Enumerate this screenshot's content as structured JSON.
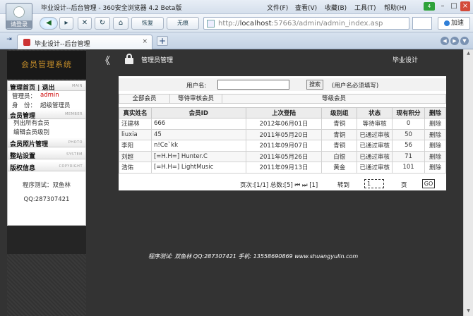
{
  "browser": {
    "title": "毕业设计--后台管理 - 360安全浏览器 4.2 Beta版",
    "menu": [
      "文件(F)",
      "查看(V)",
      "收藏(B)",
      "工具(T)",
      "帮助(H)"
    ],
    "badge_count": "4",
    "logo_label": "请登录",
    "toolbar": {
      "back_icon": "◀",
      "restore_label": "恢复",
      "notrace_label": "无痕"
    },
    "url_prefix": "http://",
    "url_host": "localhost",
    "url_rest": ":57663/admin/admin_index.asp",
    "speed_label": "加速",
    "tab_title": "毕业设计--后台管理",
    "tab_close": "×",
    "new_tab": "+"
  },
  "sidebar": {
    "banner": "会员管理系统",
    "sections": [
      {
        "title": "管理首页 | 退出",
        "en": "MAIN"
      },
      {
        "title": "会员管理",
        "en": "MEMBER"
      },
      {
        "title": "会员照片管理",
        "en": "PHOTO"
      },
      {
        "title": "整站设置",
        "en": "SYSTEM"
      },
      {
        "title": "版权信息",
        "en": "COPYRIGHT"
      }
    ],
    "admin_label": "管理员：",
    "admin_value": "admin",
    "role_label": "身　份：",
    "role_value": "超级管理员",
    "links": [
      "列出所有会员",
      "编辑会员级别"
    ],
    "tester": "程序测试：双鱼林",
    "qq": "QQ:287307421"
  },
  "header": {
    "collapse_icon": "《",
    "crumb": "管理员管理",
    "site": "毕业设计"
  },
  "search": {
    "label": "用户名:",
    "value": "",
    "button": "搜索",
    "note": "(用户名必须填写)"
  },
  "filters": [
    "全部会员",
    "等待审核会员",
    "等级会员"
  ],
  "table": {
    "headers": [
      "真实姓名",
      "会员ID",
      "上次登陆",
      "级别组",
      "状态",
      "现有积分",
      "删除"
    ],
    "rows": [
      {
        "name": "汪建林",
        "id": "666",
        "last": "2012年06月01日",
        "group": "青铜",
        "status": "等待审核",
        "status_type": "pend",
        "points": "0",
        "del": "删除"
      },
      {
        "name": "liuxia",
        "id": "45",
        "last": "2011年05月20日",
        "group": "青铜",
        "status": "已通过审核",
        "status_type": "ok",
        "points": "50",
        "del": "删除"
      },
      {
        "name": "李阳",
        "id": "n!Ce`kk",
        "last": "2011年09月07日",
        "group": "青铜",
        "status": "已通过审核",
        "status_type": "ok",
        "points": "56",
        "del": "删除"
      },
      {
        "name": "刘超",
        "id": "[=H.H=] Hunter.C",
        "last": "2011年05月26日",
        "group": "白银",
        "status": "已通过审核",
        "status_type": "ok",
        "points": "71",
        "del": "删除"
      },
      {
        "name": "浩佑",
        "id": "[=H.H=] LightMusic",
        "last": "2011年09月13日",
        "group": "黄金",
        "status": "已通过审核",
        "status_type": "ok",
        "points": "101",
        "del": "删除"
      }
    ]
  },
  "pager": {
    "info": "页次:[1/1] 总数:[5] ⏮ ⏭ [1]",
    "goto_label": "转到",
    "page_value": "1",
    "unit": "页",
    "go": "GO"
  },
  "footer": "程序测试: 双鱼林  QQ:287307421  手机: 13558690869 www.shuangyulin.com"
}
